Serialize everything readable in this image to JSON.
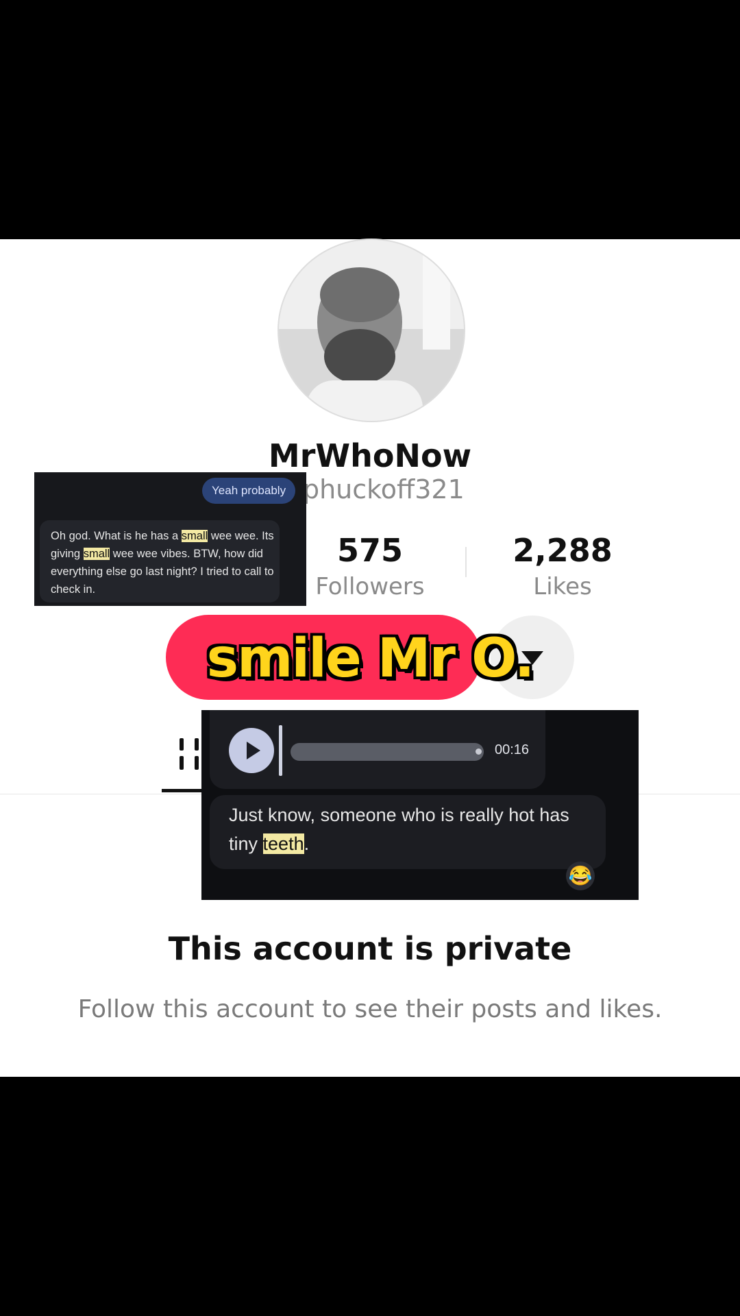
{
  "profile": {
    "display_name": "MrWhoNow",
    "username_visible": "nrphuckoff321",
    "followers_count": "575",
    "followers_label": "Followers",
    "likes_count": "2,288",
    "likes_label": "Likes",
    "more_icon": "caret-down-icon"
  },
  "caption": {
    "text": "smile Mr O.",
    "color": "#ffd41c"
  },
  "overlay_chat_1": {
    "reply_text": "Yeah probably",
    "message_parts": [
      "Oh god. What is he has a ",
      "small",
      " wee wee. Its giving ",
      "small",
      " wee wee vibes. BTW, how did everything else go last night? I tried to call to check in."
    ]
  },
  "overlay_chat_2": {
    "voice_duration": "00:16",
    "message_parts": [
      "Just know, someone who is really hot has tiny ",
      "teeth",
      "."
    ],
    "reaction": "😂"
  },
  "private_notice": {
    "title": "This account is private",
    "subtitle": "Follow this account to see their posts and likes."
  },
  "colors": {
    "accent": "#fe2c55",
    "highlight": "#f3e9a3"
  }
}
